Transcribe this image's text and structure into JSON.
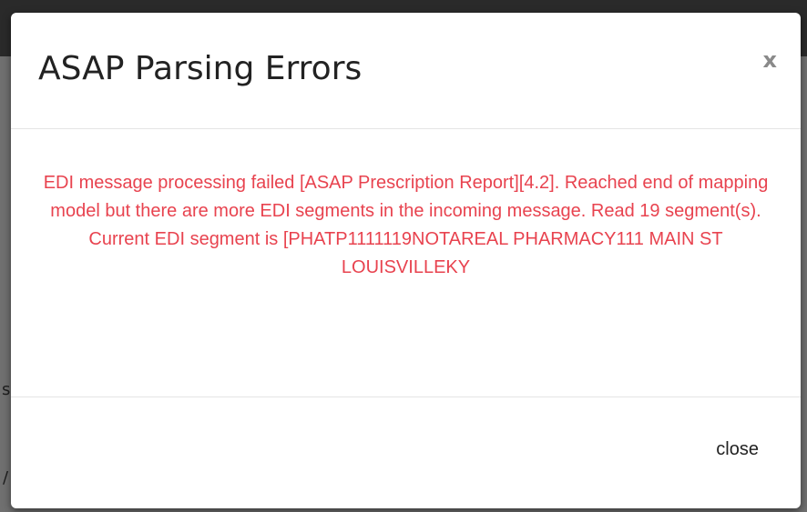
{
  "modal": {
    "title": "ASAP Parsing Errors",
    "close_icon_glyph": "x",
    "error_message": "EDI message processing failed [ASAP Prescription Report][4.2]. Reached end of mapping model but there are more EDI segments in the incoming message. Read 19 segment(s). Current EDI segment is [PHATP1111119NOTAREAL PHARMACY111 MAIN ST LOUISVILLEKY",
    "error_color": "#e8434f",
    "close_label": "close"
  },
  "background": {
    "glyph_1": "s",
    "glyph_2": "/"
  }
}
